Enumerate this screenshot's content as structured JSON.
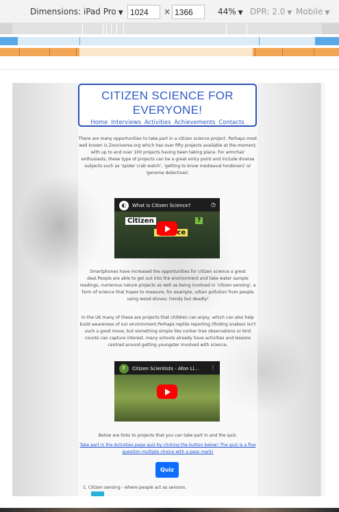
{
  "devtools": {
    "dimensions_label": "Dimensions: iPad Pro",
    "width_value": "1024",
    "times": "×",
    "height_value": "1366",
    "zoom": "44%",
    "dpr": "DPR: 2.0",
    "mode": "Mobile",
    "caret": "▼"
  },
  "site": {
    "title": "CITIZEN SCIENCE FOR EVERYONE!",
    "nav": [
      "Home",
      "Interviews",
      "Activities",
      "Achievements",
      "Contacts"
    ],
    "para1": "There are many opportunities to take part in a citizen science project. Perhaps most well known is Zooniverse.org which has over fifty projects available at the moment, with up to and over 100 projects having been taking place. For armchair enthusiasts, these type of projects can be a great entry point and include diverse subjects such as 'spider crab watch', 'getting to know medieaval londoners' or 'genome detectives'.",
    "video1": {
      "title": "What is Citizen Science?",
      "tag_citizen": "Citizen",
      "tag_science": "Science",
      "tag_q": "?"
    },
    "para2": "Smartphones have increased the opportunities for citizen science a great deal.People are able to get out into the environment and take water sample readings, numerous nature projects as well as being involved in 'citizen sensing', a form of science that hopes to measure, for example, urban pollution from people using wood stoves: trendy but deadly!",
    "para3": "In the UK many of these are projects that children can enjoy, which can also help build awareness of our environment.Perhaps reptile reporting (finding snakes) isn't such a good move, but something simple like conker tree observations or bird counts can capture interest. many schools already have activities and lessons centred around getting youngster involved with science.",
    "video2": {
      "title": "Citizen Scientists - Afon Ll...",
      "logo": "F"
    },
    "links_intro": "Below are links to projects that you can take part in and the quiz.",
    "quiz_link": "Take part in the Activities page quiz by clicking the button below! The quiz is a five question multiple choice with a pass mark!",
    "quiz_button": "Quiz",
    "list_item1": "1.  Citizen sensing - where people act as sensors."
  },
  "colors": {
    "accent": "#2d59c7",
    "button": "#0d6efd",
    "mq_blue": "#5aa9e6",
    "mq_orange": "#f2a654"
  }
}
